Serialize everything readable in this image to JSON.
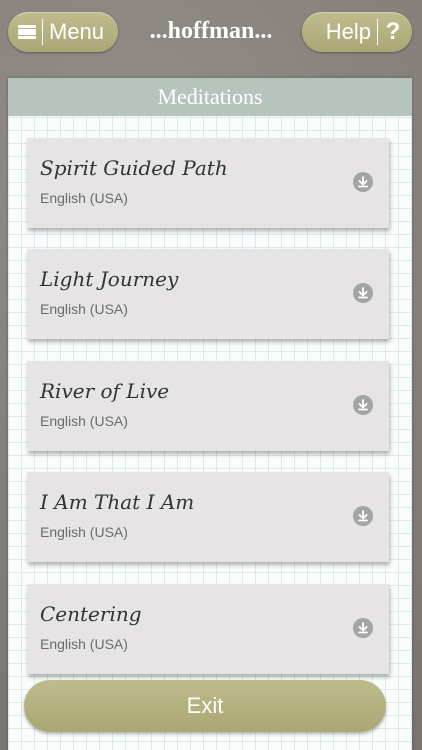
{
  "header": {
    "menu_label": "Menu",
    "brand": "...hoffman...",
    "help_label": "Help",
    "help_icon": "?"
  },
  "panel": {
    "title": "Meditations"
  },
  "meditations": [
    {
      "title": "Spirit Guided Path",
      "language": "English (USA)"
    },
    {
      "title": "Light Journey",
      "language": "English (USA)"
    },
    {
      "title": "River of Live",
      "language": "English (USA)"
    },
    {
      "title": "I Am That I Am",
      "language": "English (USA)"
    },
    {
      "title": "Centering",
      "language": "English (USA)"
    }
  ],
  "footer": {
    "exit_label": "Exit"
  },
  "icons": {
    "menu": "hamburger-menu-icon",
    "help": "question-mark-icon",
    "download": "download-arrow-icon"
  },
  "colors": {
    "accent": "#b1af7c",
    "background": "#8a8480",
    "panel_header": "#b7c4bd",
    "card": "#e6e4e4"
  }
}
